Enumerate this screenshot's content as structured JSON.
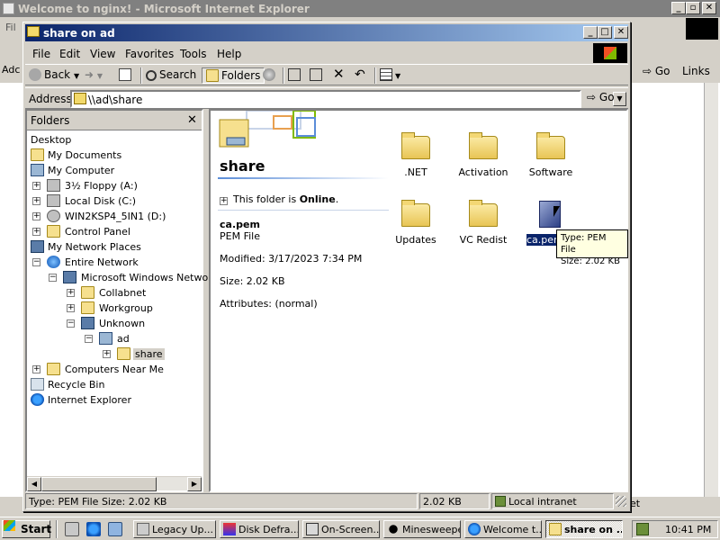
{
  "background_window": {
    "title": "Welcome to nginx! - Microsoft Internet Explorer",
    "menu_partial": "Fil",
    "address_partial": "Adc",
    "go_label": "Go",
    "links_label": "Links",
    "status_partial": "et"
  },
  "explorer": {
    "title": "share on ad",
    "menu": [
      "File",
      "Edit",
      "View",
      "Favorites",
      "Tools",
      "Help"
    ],
    "toolbar": {
      "back_label": "Back",
      "search_label": "Search",
      "folders_label": "Folders"
    },
    "address": {
      "label": "Address",
      "value": "\\\\ad\\share",
      "go_label": "Go"
    },
    "folders_pane": {
      "header": "Folders",
      "close_glyph": "✕",
      "tree": [
        {
          "label": "Desktop"
        },
        {
          "label": "My Documents"
        },
        {
          "label": "My Computer"
        },
        {
          "label": "3½ Floppy (A:)"
        },
        {
          "label": "Local Disk (C:)"
        },
        {
          "label": "WIN2KSP4_5IN1 (D:)"
        },
        {
          "label": "Control Panel"
        },
        {
          "label": "My Network Places"
        },
        {
          "label": "Entire Network"
        },
        {
          "label": "Microsoft Windows Network"
        },
        {
          "label": "Collabnet"
        },
        {
          "label": "Workgroup"
        },
        {
          "label": "Unknown"
        },
        {
          "label": "ad"
        },
        {
          "label": "share"
        },
        {
          "label": "Computers Near Me"
        },
        {
          "label": "Recycle Bin"
        },
        {
          "label": "Internet Explorer"
        }
      ]
    },
    "webview": {
      "title": "share",
      "online_prefix": "This folder is",
      "online_status": "Online",
      "online_suffix": ".",
      "selected_name": "ca.pem",
      "selected_type": "PEM File",
      "modified": "Modified: 3/17/2023 7:34 PM",
      "size": "Size: 2.02 KB",
      "attributes": "Attributes: (normal)"
    },
    "items": [
      {
        "label": ".NET"
      },
      {
        "label": "Activation"
      },
      {
        "label": "Software"
      },
      {
        "label": "Updates"
      },
      {
        "label": "VC Redist"
      },
      {
        "label": "ca.pem"
      }
    ],
    "tooltip": {
      "line1": "Type: PEM File",
      "line2": "Size: 2.02 KB"
    },
    "status": {
      "info": "Type: PEM File Size: 2.02 KB",
      "size": "2.02 KB",
      "zone": "Local intranet"
    }
  },
  "taskbar": {
    "start_label": "Start",
    "tasks": [
      {
        "label": "Legacy Up..."
      },
      {
        "label": "Disk Defra..."
      },
      {
        "label": "On-Screen..."
      },
      {
        "label": "Minesweeper"
      },
      {
        "label": "Welcome t..."
      },
      {
        "label": "share on ..."
      }
    ],
    "clock": "10:41 PM"
  }
}
